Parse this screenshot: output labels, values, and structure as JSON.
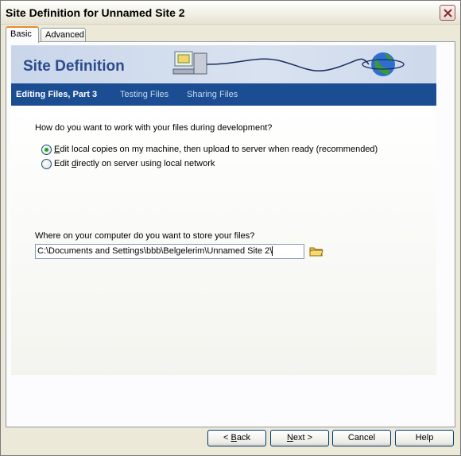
{
  "window": {
    "title": "Site Definition for Unnamed Site 2"
  },
  "tabs": [
    {
      "label": "Basic",
      "active": true
    },
    {
      "label": "Advanced",
      "active": false
    }
  ],
  "banner": {
    "title": "Site Definition"
  },
  "steps": [
    {
      "label": "Editing Files, Part 3",
      "current": true
    },
    {
      "label": "Testing Files",
      "current": false
    },
    {
      "label": "Sharing Files",
      "current": false
    }
  ],
  "work_question": "How do you want to work with your files during development?",
  "options": [
    {
      "accel": "E",
      "rest": "dit local copies on my machine, then upload to server when ready (recommended)",
      "selected": true
    },
    {
      "pre": "Edit ",
      "accel": "d",
      "rest": "irectly on server using local network",
      "selected": false
    }
  ],
  "store_question": "Where on your computer do you want to store your files?",
  "store_path": "C:\\Documents and Settings\\bbb\\Belgelerim\\Unnamed Site 2\\",
  "buttons": {
    "back": {
      "pre": "< ",
      "accel": "B",
      "rest": "ack"
    },
    "next": {
      "accel": "N",
      "rest": "ext >"
    },
    "cancel": "Cancel",
    "help": "Help"
  },
  "colors": {
    "stepbar": "#1b4d92",
    "banner_title": "#2c4b8a",
    "radio_dot": "#21a121"
  }
}
